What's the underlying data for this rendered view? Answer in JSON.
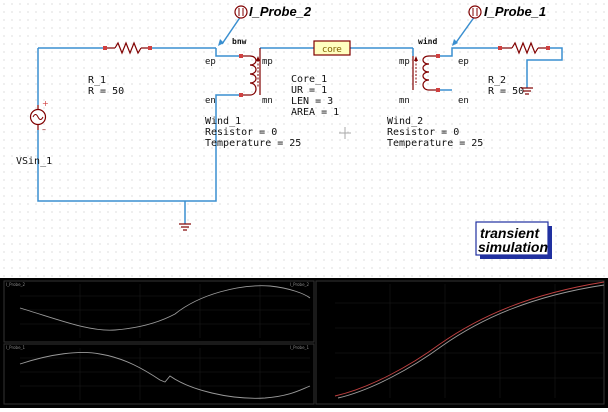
{
  "probes": {
    "probe_2": "I_Probe_2",
    "probe_1": "I_Probe_1"
  },
  "source": {
    "name": "VSin_1",
    "plus": "+",
    "minus": "–"
  },
  "resistors": {
    "r1": {
      "name": "R_1",
      "param": "R = 50"
    },
    "r2": {
      "name": "R_2",
      "param": "R = 50"
    }
  },
  "wind_1": {
    "label": "bnw",
    "ports": {
      "ep": "ep",
      "en": "en",
      "mp": "mp",
      "mn": "mn"
    },
    "name": "Wind_1",
    "params": [
      "Resistor = 0",
      "Temperature = 25"
    ]
  },
  "wind_2": {
    "label": "wind",
    "ports": {
      "ep": "ep",
      "en": "en",
      "mp": "mp",
      "mn": "mn"
    },
    "name": "Wind_2",
    "params": [
      "Resistor = 0",
      "Temperature = 25"
    ]
  },
  "core": {
    "label": "core",
    "name": "Core_1",
    "params": [
      "UR = 1",
      "LEN = 3",
      "AREA = 1"
    ]
  },
  "simulation": {
    "line1": "transient",
    "line2": "simulation"
  },
  "colors": {
    "wire": "#3a8fd0",
    "component": "#800000",
    "pin": "#d04040",
    "core_fill": "#ffffc0",
    "plot_bg": "#000000",
    "trace_light": "#9a9a9a",
    "trace_red": "#c04040"
  },
  "plot_panels": {
    "top_left": {
      "ylabel": "I_Probe_2",
      "legend": "I_Probe_2"
    },
    "bottom_left": {
      "ylabel": "I_Probe_1",
      "legend": "I_Probe_1"
    }
  }
}
